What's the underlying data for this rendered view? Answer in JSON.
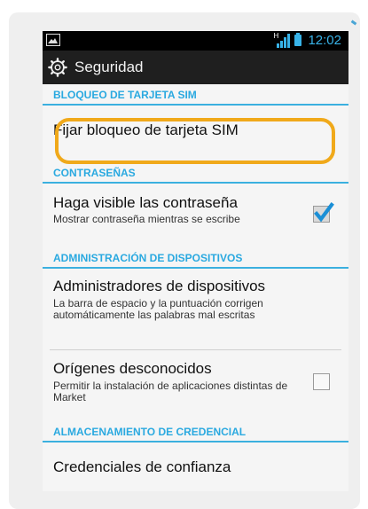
{
  "statusbar": {
    "time": "12:02",
    "network_type": "H"
  },
  "titlebar": {
    "title": "Seguridad",
    "icon": "gear-icon"
  },
  "sections": {
    "sim_lock": {
      "header": "BLOQUEO DE TARJETA SIM"
    },
    "passwords": {
      "header": "CONTRASEÑAS"
    },
    "device_admin": {
      "header": "ADMINISTRACIÓN DE DISPOSITIVOS"
    },
    "credential_storage": {
      "header": "ALMACENAMIENTO DE CREDENCIAL"
    }
  },
  "items": {
    "set_sim_lock": {
      "title": "Fijar bloqueo de tarjeta SIM"
    },
    "visible_passwords": {
      "title": "Haga visible las contraseña",
      "subtitle": "Mostrar contraseña mientras se escribe",
      "checked": true
    },
    "device_admins": {
      "title": "Administradores de dispositivos",
      "subtitle": "La barra de espacio y la puntuación corrigen automáticamente las palabras mal escritas"
    },
    "unknown_sources": {
      "title": "Orígenes desconocidos",
      "subtitle": "Permitir la instalación de aplicaciones distintas de Market",
      "checked": false
    },
    "trusted_credentials": {
      "title": "Credenciales de confianza"
    }
  },
  "colors": {
    "accent_blue": "#2aa9e0",
    "highlight_orange": "#f0a91a",
    "check_blue": "#1a8fd6"
  }
}
